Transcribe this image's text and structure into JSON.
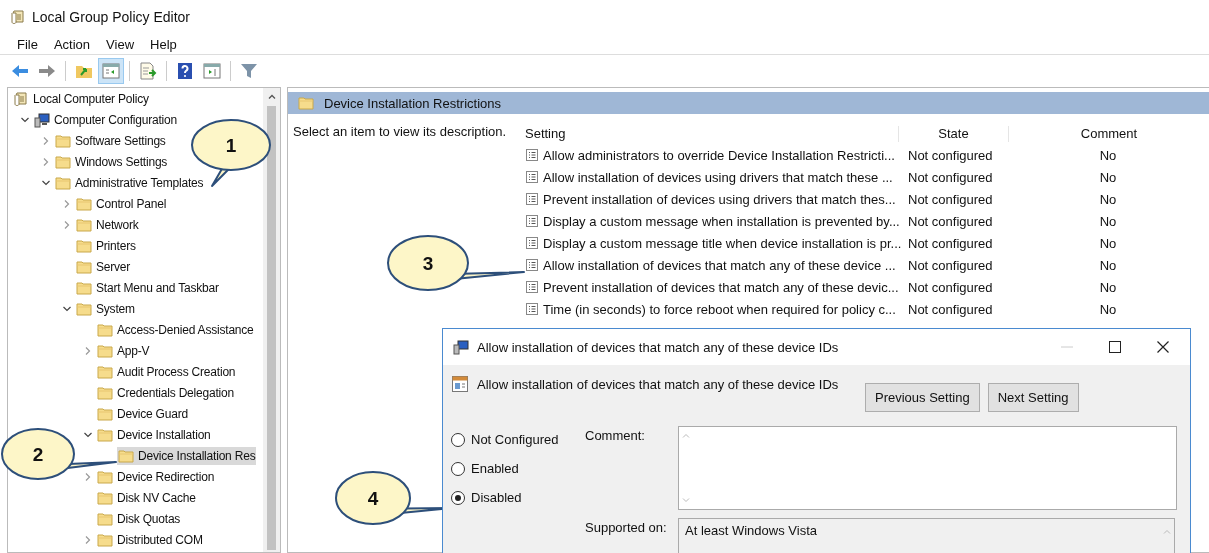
{
  "window": {
    "title": "Local Group Policy Editor"
  },
  "menu": [
    "File",
    "Action",
    "View",
    "Help"
  ],
  "toolbar": [
    {
      "kind": "back",
      "pressed": false
    },
    {
      "kind": "forward",
      "pressed": false
    },
    {
      "kind": "up",
      "pressed": false
    },
    {
      "kind": "tree",
      "pressed": true
    },
    {
      "kind": "export",
      "pressed": false
    },
    {
      "kind": "help",
      "pressed": false
    },
    {
      "kind": "pane",
      "pressed": false
    },
    {
      "kind": "filter",
      "pressed": false
    }
  ],
  "tree": {
    "items": [
      {
        "label": "Local Computer Policy",
        "kind": "policy",
        "selected": false,
        "children": [
          {
            "label": "Computer Configuration",
            "kind": "computer",
            "expander": true,
            "expanded": true,
            "selected": false,
            "children": [
              {
                "label": "Software Settings",
                "kind": "folder",
                "expander": true,
                "expanded": false,
                "selected": false
              },
              {
                "label": "Windows Settings",
                "kind": "folder",
                "expander": true,
                "expanded": false,
                "selected": false
              },
              {
                "label": "Administrative Templates",
                "kind": "folder",
                "expander": true,
                "expanded": true,
                "selected": false,
                "children": [
                  {
                    "label": "Control Panel",
                    "kind": "folder",
                    "expander": true,
                    "expanded": false,
                    "selected": false
                  },
                  {
                    "label": "Network",
                    "kind": "folder",
                    "expander": true,
                    "expanded": false,
                    "selected": false
                  },
                  {
                    "label": "Printers",
                    "kind": "folder",
                    "expander": false,
                    "expanded": false,
                    "selected": false
                  },
                  {
                    "label": "Server",
                    "kind": "folder",
                    "expander": false,
                    "expanded": false,
                    "selected": false
                  },
                  {
                    "label": "Start Menu and Taskbar",
                    "kind": "folder",
                    "expander": false,
                    "expanded": false,
                    "selected": false
                  },
                  {
                    "label": "System",
                    "kind": "folder",
                    "expander": true,
                    "expanded": true,
                    "selected": false,
                    "children": [
                      {
                        "label": "Access-Denied Assistance",
                        "kind": "folder",
                        "expander": false,
                        "expanded": false,
                        "selected": false
                      },
                      {
                        "label": "App-V",
                        "kind": "folder",
                        "expander": true,
                        "expanded": false,
                        "selected": false
                      },
                      {
                        "label": "Audit Process Creation",
                        "kind": "folder",
                        "expander": false,
                        "expanded": false,
                        "selected": false
                      },
                      {
                        "label": "Credentials Delegation",
                        "kind": "folder",
                        "expander": false,
                        "expanded": false,
                        "selected": false
                      },
                      {
                        "label": "Device Guard",
                        "kind": "folder",
                        "expander": false,
                        "expanded": false,
                        "selected": false
                      },
                      {
                        "label": "Device Installation",
                        "kind": "folder",
                        "expander": true,
                        "expanded": true,
                        "selected": false,
                        "children": [
                          {
                            "label": "Device Installation Res",
                            "kind": "folder",
                            "expander": false,
                            "expanded": false,
                            "selected": true
                          }
                        ]
                      },
                      {
                        "label": "Device Redirection",
                        "kind": "folder",
                        "expander": true,
                        "expanded": false,
                        "selected": false
                      },
                      {
                        "label": "Disk NV Cache",
                        "kind": "folder",
                        "expander": false,
                        "expanded": false,
                        "selected": false
                      },
                      {
                        "label": "Disk Quotas",
                        "kind": "folder",
                        "expander": false,
                        "expanded": false,
                        "selected": false
                      },
                      {
                        "label": "Distributed COM",
                        "kind": "folder",
                        "expander": true,
                        "expanded": false,
                        "selected": false
                      }
                    ]
                  }
                ]
              }
            ]
          }
        ]
      }
    ]
  },
  "details": {
    "title": "Device Installation Restrictions",
    "description": "Select an item to view its description.",
    "columns": [
      "Setting",
      "State",
      "Comment"
    ],
    "rows": [
      {
        "setting": "Allow administrators to override Device Installation Restricti...",
        "state": "Not configured",
        "comment": "No"
      },
      {
        "setting": "Allow installation of devices using drivers that match these ...",
        "state": "Not configured",
        "comment": "No"
      },
      {
        "setting": "Prevent installation of devices using drivers that match thes...",
        "state": "Not configured",
        "comment": "No"
      },
      {
        "setting": "Display a custom message when installation is prevented by...",
        "state": "Not configured",
        "comment": "No"
      },
      {
        "setting": "Display a custom message title when device installation is pr...",
        "state": "Not configured",
        "comment": "No"
      },
      {
        "setting": "Allow installation of devices that match any of these device ...",
        "state": "Not configured",
        "comment": "No"
      },
      {
        "setting": "Prevent installation of devices that match any of these devic...",
        "state": "Not configured",
        "comment": "No"
      },
      {
        "setting": "Time (in seconds) to force reboot when required for policy c...",
        "state": "Not configured",
        "comment": "No"
      }
    ]
  },
  "dialog": {
    "title": "Allow installation of devices that match any of these device IDs",
    "heading": "Allow installation of devices that match any of these device IDs",
    "buttons": [
      "Previous Setting",
      "Next Setting"
    ],
    "options": [
      {
        "label": "Not Configured",
        "selected": false
      },
      {
        "label": "Enabled",
        "selected": false
      },
      {
        "label": "Disabled",
        "selected": true
      }
    ],
    "comment_label": "Comment:",
    "supported_label": "Supported on:",
    "supported_value": "At least Windows Vista"
  },
  "callouts": [
    "1",
    "2",
    "3",
    "4"
  ]
}
